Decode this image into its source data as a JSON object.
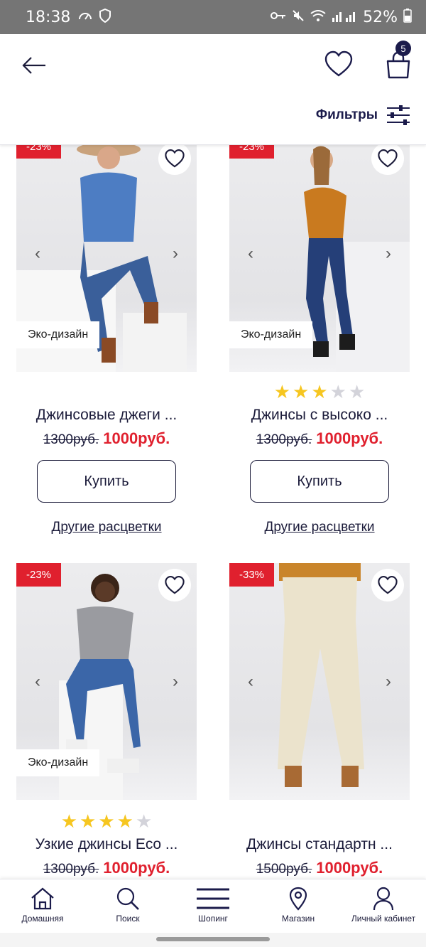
{
  "status_bar": {
    "time": "18:38",
    "battery": "52%"
  },
  "header": {
    "cart_count": "5",
    "filters_label": "Фильтры"
  },
  "products": [
    {
      "discount": "-23%",
      "eco_label": "Эко-дизайн",
      "title": "Джинсовые джеги ...",
      "old_price": "1300руб.",
      "new_price": "1000руб.",
      "buy_label": "Купить",
      "colors_link": "Другие расцветки"
    },
    {
      "discount": "-23%",
      "eco_label": "Эко-дизайн",
      "rating": 3,
      "title": "Джинсы с высоко ...",
      "old_price": "1300руб.",
      "new_price": "1000руб.",
      "buy_label": "Купить",
      "colors_link": "Другие расцветки"
    },
    {
      "discount": "-23%",
      "eco_label": "Эко-дизайн",
      "rating": 4,
      "title": "Узкие джинсы Eco ...",
      "old_price": "1300руб.",
      "new_price": "1000руб."
    },
    {
      "discount": "-33%",
      "title": "Джинсы стандартн ...",
      "old_price": "1500руб.",
      "new_price": "1000руб."
    }
  ],
  "bottom_nav": [
    {
      "label": "Домашняя",
      "icon": "home-icon"
    },
    {
      "label": "Поиск",
      "icon": "search-icon"
    },
    {
      "label": "Шопинг",
      "icon": "menu-icon"
    },
    {
      "label": "Магазин",
      "icon": "location-pin-icon"
    },
    {
      "label": "Личный кабинет",
      "icon": "user-icon"
    }
  ],
  "colors": {
    "accent_red": "#e0202e",
    "navy": "#1b1b4b",
    "star_gold": "#f6c620"
  }
}
